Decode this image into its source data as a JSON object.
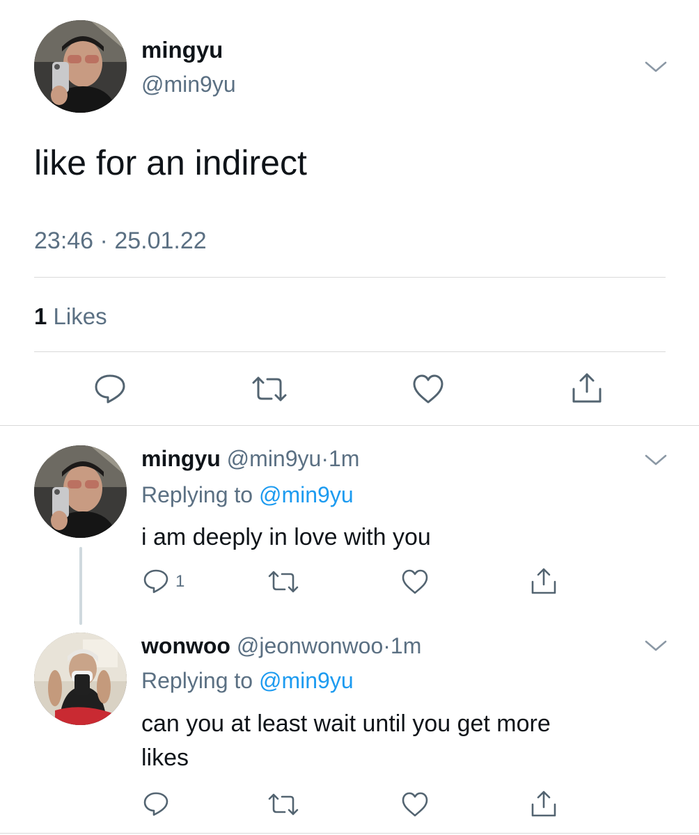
{
  "main_tweet": {
    "display_name": "mingyu",
    "handle": "@min9yu",
    "text": "like for an indirect",
    "time": "23:46",
    "separator": "·",
    "date": "25.01.22",
    "likes_count": "1",
    "likes_label": "Likes",
    "avatar_icon": "avatar-mingyu",
    "actions": [
      "reply-icon",
      "retweet-icon",
      "like-icon",
      "share-icon"
    ]
  },
  "replies": [
    {
      "display_name": "mingyu",
      "handle": "@min9yu",
      "separator": "·",
      "time_ago": "1m",
      "replying_prefix": "Replying to",
      "replying_handle": "@min9yu",
      "text_lines": [
        "i am deeply in love with you"
      ],
      "reply_count": "1",
      "avatar_icon": "avatar-mingyu"
    },
    {
      "display_name": "wonwoo",
      "handle": "@jeonwonwoo",
      "separator": "·",
      "time_ago": "1m",
      "replying_prefix": "Replying to",
      "replying_handle": "@min9yu",
      "text_lines": [
        "can you at least wait until you get more",
        "likes"
      ],
      "reply_count": "",
      "avatar_icon": "avatar-wonwoo"
    }
  ],
  "colors": {
    "text": "#0f1419",
    "muted": "#5b7083",
    "link": "#1d9bf0",
    "divider": "#d9d9d9",
    "thread_line": "#cfd9de"
  }
}
